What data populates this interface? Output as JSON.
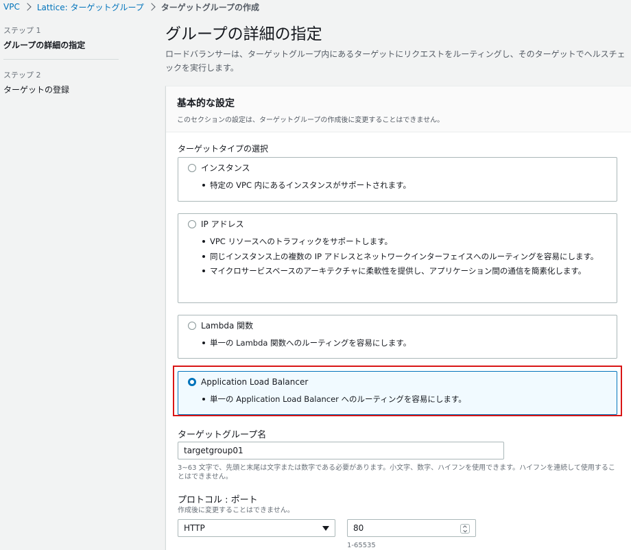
{
  "breadcrumb": {
    "items": [
      "VPC",
      "Lattice: ターゲットグループ"
    ],
    "current": "ターゲットグループの作成"
  },
  "steps": [
    {
      "label": "ステップ 1",
      "title": "グループの詳細の指定"
    },
    {
      "label": "ステップ 2",
      "title": "ターゲットの登録"
    }
  ],
  "page": {
    "title": "グループの詳細の指定",
    "description": "ロードバランサーは、ターゲットグループ内にあるターゲットにリクエストをルーティングし、そのターゲットでヘルスチェックを実行します。"
  },
  "panel": {
    "title": "基本的な設定",
    "description": "このセクションの設定は、ターゲットグループの作成後に変更することはできません。"
  },
  "target_type": {
    "label": "ターゲットタイプの選択",
    "selected": "Application Load Balancer",
    "options": [
      {
        "title": "インスタンス",
        "bullets": [
          "特定の VPC 内にあるインスタンスがサポートされます。"
        ]
      },
      {
        "title": "IP アドレス",
        "bullets": [
          "VPC リソースへのトラフィックをサポートします。",
          "同じインスタンス上の複数の IP アドレスとネットワークインターフェイスへのルーティングを容易にします。",
          "マイクロサービスベースのアーキテクチャに柔軟性を提供し、アプリケーション間の通信を簡素化します。"
        ]
      },
      {
        "title": "Lambda 関数",
        "bullets": [
          "単一の Lambda 関数へのルーティングを容易にします。"
        ]
      },
      {
        "title": "Application Load Balancer",
        "bullets": [
          "単一の Application Load Balancer へのルーティングを容易にします。"
        ]
      }
    ]
  },
  "target_group_name": {
    "label": "ターゲットグループ名",
    "value": "targetgroup01",
    "hint": "3~63 文字で、先頭と末尾は文字または数字である必要があります。小文字、数字、ハイフンを使用できます。ハイフンを連続して使用することはできません。"
  },
  "protocol_port": {
    "label": "プロトコル : ポート",
    "description": "作成後に変更することはできません。",
    "protocol": "HTTP",
    "port": "80",
    "port_hint": "1-65535"
  },
  "colors": {
    "link": "#0073bb",
    "selected_border": "#0073bb",
    "selected_bg": "#f1faff",
    "highlight": "#d91515"
  }
}
